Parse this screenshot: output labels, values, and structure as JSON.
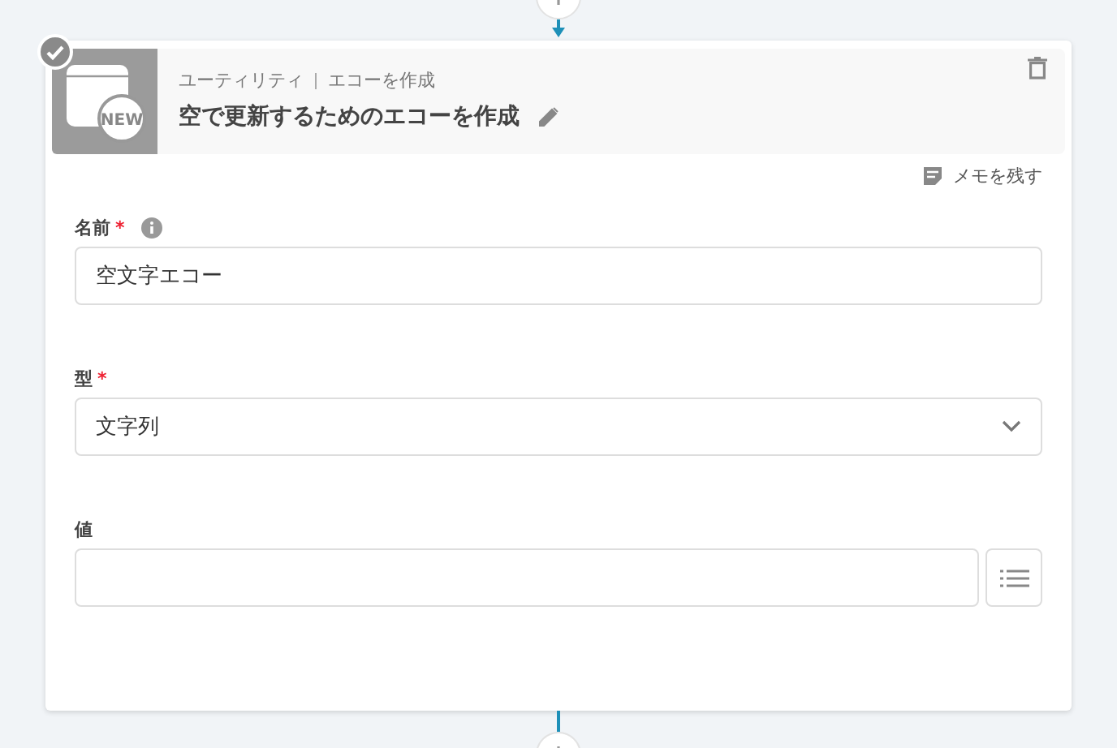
{
  "step": {
    "category": "ユーティリティ",
    "action": "エコーを作成",
    "title": "空で更新するためのエコーを作成",
    "badge": "NEW",
    "done": true
  },
  "memo_link": "メモを残す",
  "fields": [
    {
      "kind": "text",
      "label": "名前",
      "required_mark": "*",
      "info": true,
      "value": "空文字エコー"
    },
    {
      "kind": "select",
      "label": "型",
      "required_mark": "*",
      "info": false,
      "value": "文字列"
    },
    {
      "kind": "list-input",
      "label": "値",
      "info": false
    }
  ]
}
